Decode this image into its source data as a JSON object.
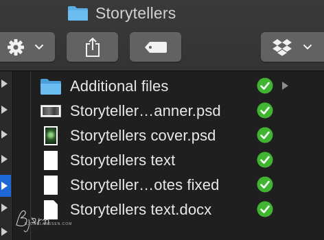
{
  "window": {
    "title": "Storytellers"
  },
  "toolbar": {
    "buttons": [
      {
        "name": "action-gear",
        "icon": "gear-icon",
        "has_menu": true
      },
      {
        "name": "share",
        "icon": "share-icon"
      },
      {
        "name": "tags",
        "icon": "tag-icon"
      },
      {
        "name": "dropbox",
        "icon": "dropbox-icon",
        "has_menu": true
      }
    ]
  },
  "files": [
    {
      "name": "Additional files",
      "type": "folder",
      "icon": "folder-icon",
      "synced": true,
      "expandable": true
    },
    {
      "name": "Storyteller…anner.psd",
      "type": "psd",
      "icon": "image-thumbnail-icon",
      "synced": true
    },
    {
      "name": "Storytellers cover.psd",
      "type": "psd",
      "icon": "image-thumbnail-icon",
      "synced": true
    },
    {
      "name": "Storytellers text",
      "type": "document",
      "icon": "document-icon",
      "synced": true
    },
    {
      "name": "Storyteller…otes fixed",
      "type": "document",
      "icon": "document-icon",
      "synced": true
    },
    {
      "name": "Storytellers text.docx",
      "type": "docx",
      "icon": "document-icon",
      "synced": true
    }
  ],
  "watermark": {
    "signature": "Bjørn",
    "caption": "BJORNLARSSEN.COM"
  },
  "colors": {
    "accent": "#1e67d6",
    "sync_green": "#3fb532",
    "folder_blue": "#5aafe8"
  }
}
